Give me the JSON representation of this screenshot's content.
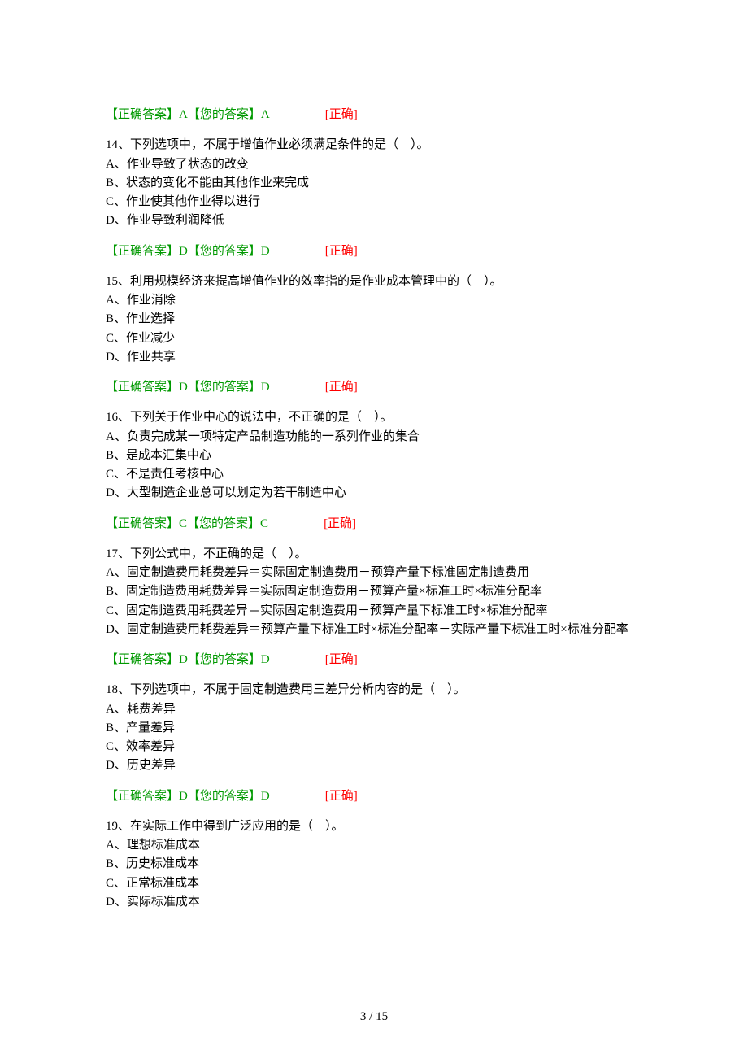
{
  "answers": {
    "a13": {
      "correct_label": "【正确答案】",
      "correct_value": "A",
      "your_label": "【您的答案】",
      "your_value": "A",
      "status": "[正确]"
    },
    "a14": {
      "correct_label": "【正确答案】",
      "correct_value": "D",
      "your_label": "【您的答案】",
      "your_value": "D",
      "status": "[正确]"
    },
    "a15": {
      "correct_label": "【正确答案】",
      "correct_value": "D",
      "your_label": "【您的答案】",
      "your_value": "D",
      "status": "[正确]"
    },
    "a16": {
      "correct_label": "【正确答案】",
      "correct_value": "C",
      "your_label": "【您的答案】",
      "your_value": "C",
      "status": "[正确]"
    },
    "a17": {
      "correct_label": "【正确答案】",
      "correct_value": "D",
      "your_label": "【您的答案】",
      "your_value": "D",
      "status": "[正确]"
    },
    "a18": {
      "correct_label": "【正确答案】",
      "correct_value": "D",
      "your_label": "【您的答案】",
      "your_value": "D",
      "status": "[正确]"
    }
  },
  "questions": {
    "q14": {
      "text": "14、下列选项中，不属于增值作业必须满足条件的是（　）。",
      "A": "A、作业导致了状态的改变",
      "B": "B、状态的变化不能由其他作业来完成",
      "C": "C、作业使其他作业得以进行",
      "D": "D、作业导致利润降低"
    },
    "q15": {
      "text": "15、利用规模经济来提高增值作业的效率指的是作业成本管理中的（　）。",
      "A": "A、作业消除",
      "B": "B、作业选择",
      "C": "C、作业减少",
      "D": "D、作业共享"
    },
    "q16": {
      "text": "16、下列关于作业中心的说法中，不正确的是（　）。",
      "A": "A、负责完成某一项特定产品制造功能的一系列作业的集合",
      "B": "B、是成本汇集中心",
      "C": "C、不是责任考核中心",
      "D": "D、大型制造企业总可以划定为若干制造中心"
    },
    "q17": {
      "text": "17、下列公式中，不正确的是（　）。",
      "A": "A、固定制造费用耗费差异＝实际固定制造费用－预算产量下标准固定制造费用",
      "B": "B、固定制造费用耗费差异＝实际固定制造费用－预算产量×标准工时×标准分配率",
      "C": "C、固定制造费用耗费差异＝实际固定制造费用－预算产量下标准工时×标准分配率",
      "D": "D、固定制造费用耗费差异＝预算产量下标准工时×标准分配率－实际产量下标准工时×标准分配率"
    },
    "q18": {
      "text": "18、下列选项中，不属于固定制造费用三差异分析内容的是（　）。",
      "A": "A、耗费差异",
      "B": "B、产量差异",
      "C": "C、效率差异",
      "D": "D、历史差异"
    },
    "q19": {
      "text": "19、在实际工作中得到广泛应用的是（　）。",
      "A": "A、理想标准成本",
      "B": "B、历史标准成本",
      "C": "C、正常标准成本",
      "D": "D、实际标准成本"
    }
  },
  "footer": "3 / 15"
}
